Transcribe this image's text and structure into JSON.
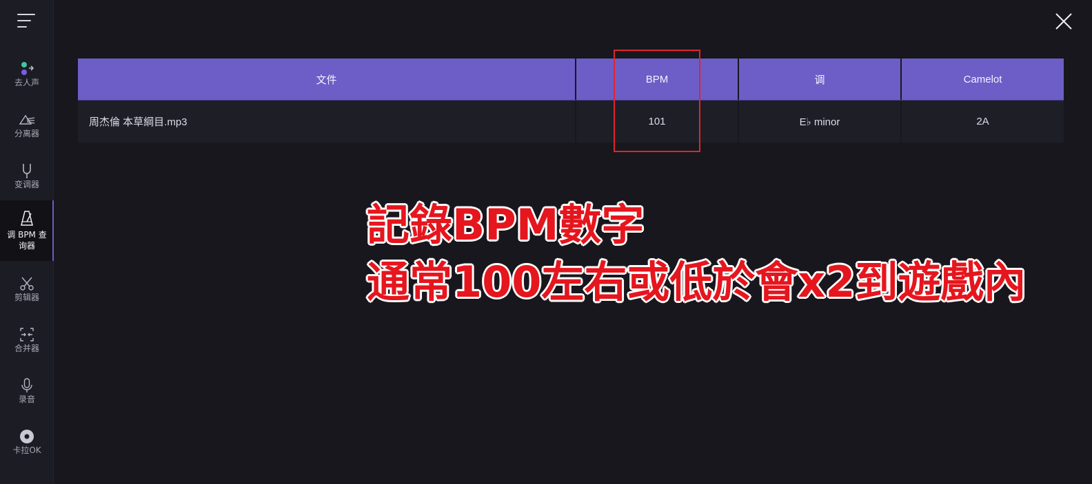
{
  "sidebar": {
    "items": [
      {
        "label": "去人声",
        "icon": "vocal-remover-icon"
      },
      {
        "label": "分离器",
        "icon": "prism-splitter-icon"
      },
      {
        "label": "变调器",
        "icon": "tuning-fork-icon"
      },
      {
        "label": "调 BPM 查\n询器",
        "icon": "metronome-icon",
        "active": true
      },
      {
        "label": "剪辑器",
        "icon": "scissors-icon"
      },
      {
        "label": "合并器",
        "icon": "merge-icon"
      },
      {
        "label": "录音",
        "icon": "microphone-icon"
      },
      {
        "label": "卡拉OK",
        "icon": "disc-icon"
      }
    ]
  },
  "table": {
    "headers": {
      "file": "文件",
      "bpm": "BPM",
      "key": "调",
      "camelot": "Camelot"
    },
    "rows": [
      {
        "file": "周杰倫 本草綱目.mp3",
        "bpm": "101",
        "key": "E♭ minor",
        "camelot": "2A"
      }
    ]
  },
  "annotation": {
    "line1": "記錄BPM數字",
    "line2": "通常100左右或低於會x2到遊戲內"
  },
  "colors": {
    "accent": "#6c5ec6",
    "background": "#17171d",
    "highlight": "#e0262b",
    "annotation": "#e5161e"
  }
}
